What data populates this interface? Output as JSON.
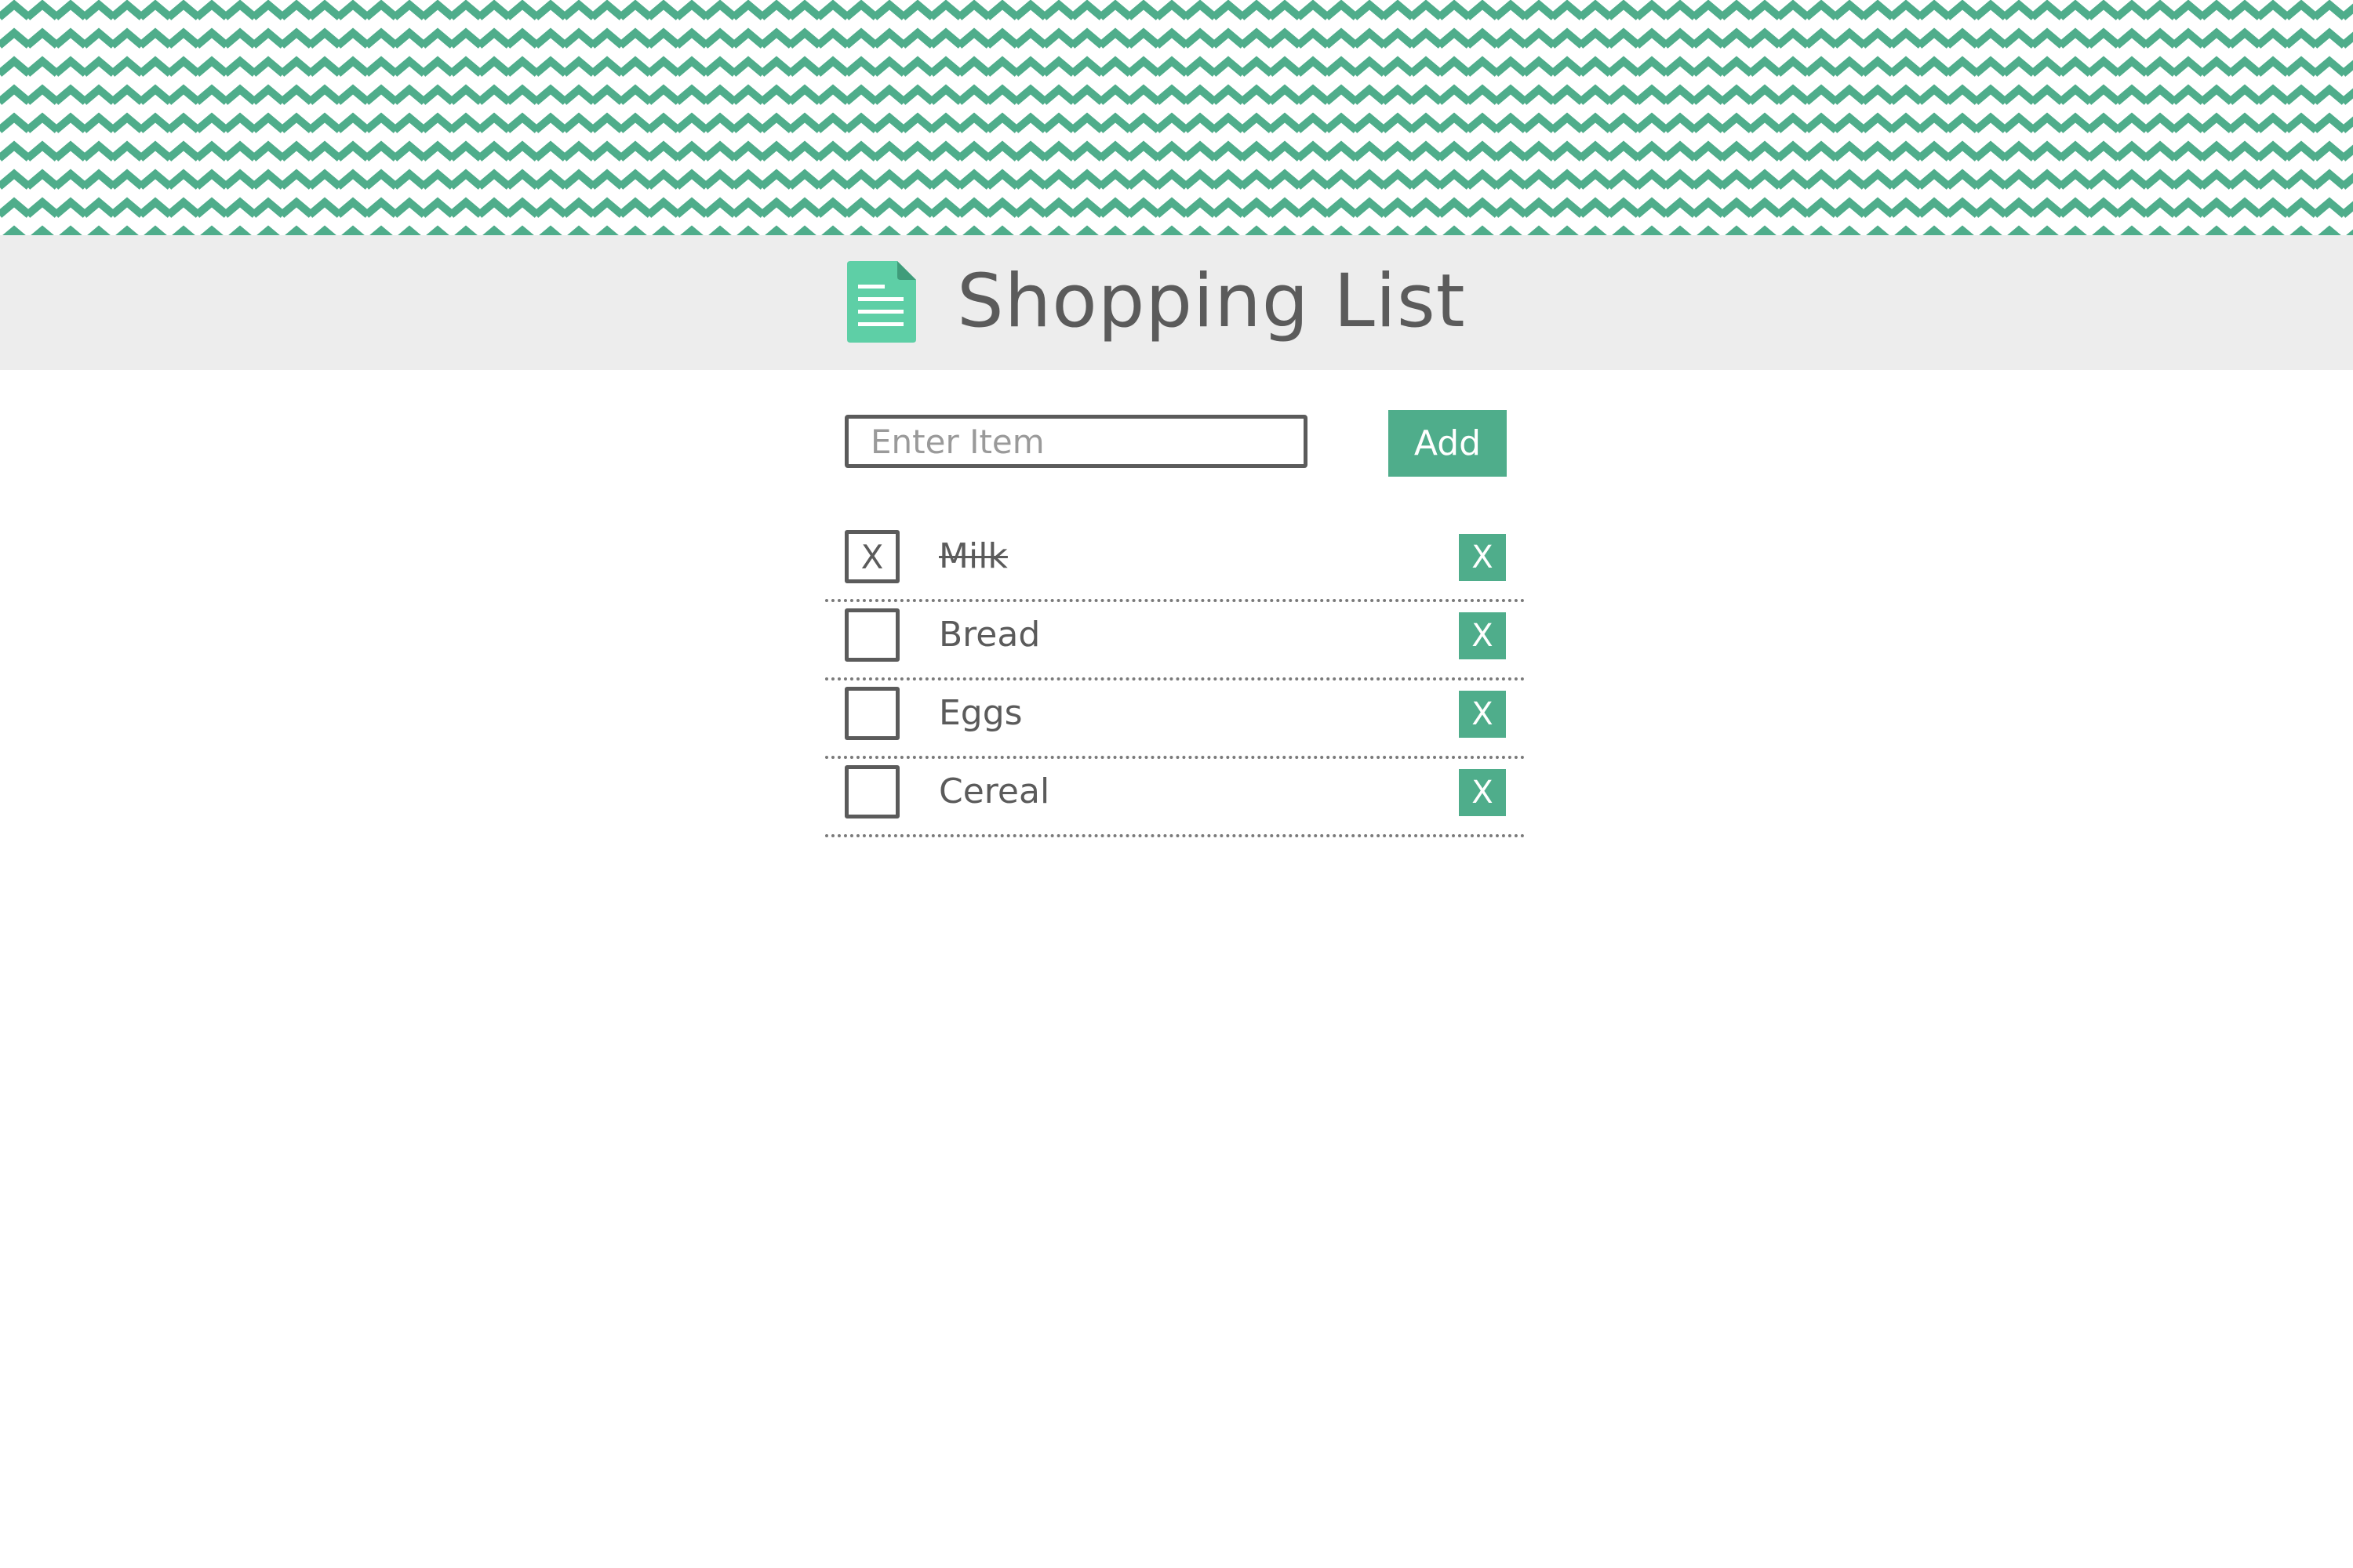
{
  "header": {
    "title": "Shopping List",
    "icon": "document-icon"
  },
  "entry": {
    "placeholder": "Enter Item",
    "value": "",
    "add_label": "Add"
  },
  "items": [
    {
      "label": "Milk",
      "checked": true,
      "check_mark": "X",
      "delete_label": "X"
    },
    {
      "label": "Bread",
      "checked": false,
      "check_mark": "",
      "delete_label": "X"
    },
    {
      "label": "Eggs",
      "checked": false,
      "check_mark": "",
      "delete_label": "X"
    },
    {
      "label": "Cereal",
      "checked": false,
      "check_mark": "",
      "delete_label": "X"
    }
  ],
  "colors": {
    "accent": "#4fad8b",
    "chevron": "#4fad8b",
    "header_bg": "#ededed",
    "text": "#5b5b5b",
    "icon_light": "#5ecfa6"
  }
}
